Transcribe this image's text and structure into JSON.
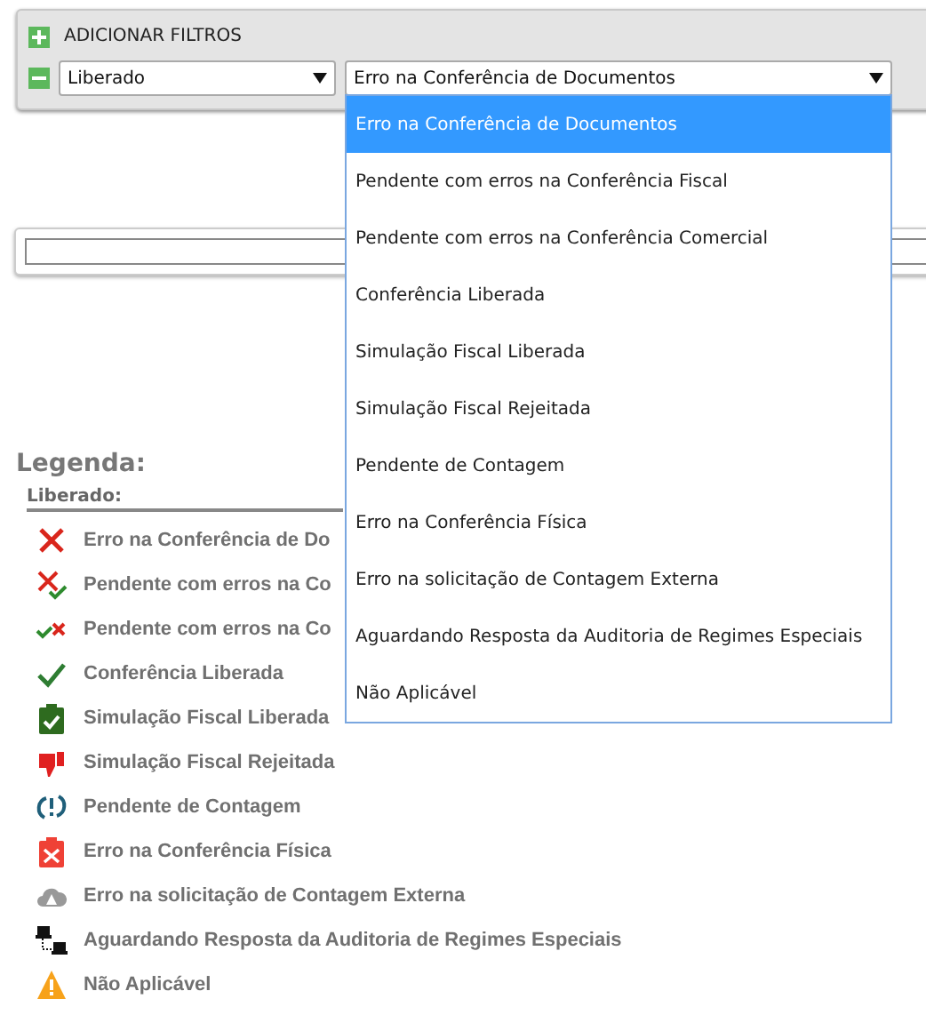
{
  "filter_panel": {
    "title": "ADICIONAR FILTROS",
    "status_select": {
      "value": "Liberado",
      "expanded": false
    },
    "detail_select": {
      "value": "Erro na Conferência de Documentos",
      "expanded": true,
      "options": [
        {
          "label": "Erro na Conferência de Documentos",
          "selected": true
        },
        {
          "label": "Pendente com erros na Conferência Fiscal",
          "selected": false
        },
        {
          "label": "Pendente com erros na Conferência Comercial",
          "selected": false
        },
        {
          "label": "Conferência Liberada",
          "selected": false
        },
        {
          "label": "Simulação Fiscal Liberada",
          "selected": false
        },
        {
          "label": "Simulação Fiscal Rejeitada",
          "selected": false
        },
        {
          "label": "Pendente de Contagem",
          "selected": false
        },
        {
          "label": "Erro na Conferência Física",
          "selected": false
        },
        {
          "label": "Erro na solicitação de Contagem Externa",
          "selected": false
        },
        {
          "label": "Aguardando Resposta da Auditoria de Regimes Especiais",
          "selected": false
        },
        {
          "label": "Não Aplicável",
          "selected": false
        }
      ]
    }
  },
  "legend": {
    "title": "Legenda:",
    "group": "Liberado:",
    "items": [
      {
        "kind": "error",
        "label": "Erro na Conferência de Do"
      },
      {
        "kind": "error_check",
        "label": "Pendente com erros na Co"
      },
      {
        "kind": "check_error",
        "label": "Pendente com erros na Co"
      },
      {
        "kind": "check",
        "label": "Conferência Liberada"
      },
      {
        "kind": "clipboard_check",
        "label": "Simulação Fiscal Liberada"
      },
      {
        "kind": "thumbs_down",
        "label": "Simulação Fiscal Rejeitada"
      },
      {
        "kind": "refresh_alert",
        "label": "Pendente de Contagem"
      },
      {
        "kind": "clipboard_error",
        "label": "Erro na Conferência Física"
      },
      {
        "kind": "cloud_warning",
        "label": "Erro na solicitação de Contagem Externa"
      },
      {
        "kind": "network",
        "label": "Aguardando Resposta da Auditoria de Regimes Especiais"
      },
      {
        "kind": "warning",
        "label": "Não Aplicável"
      }
    ]
  }
}
